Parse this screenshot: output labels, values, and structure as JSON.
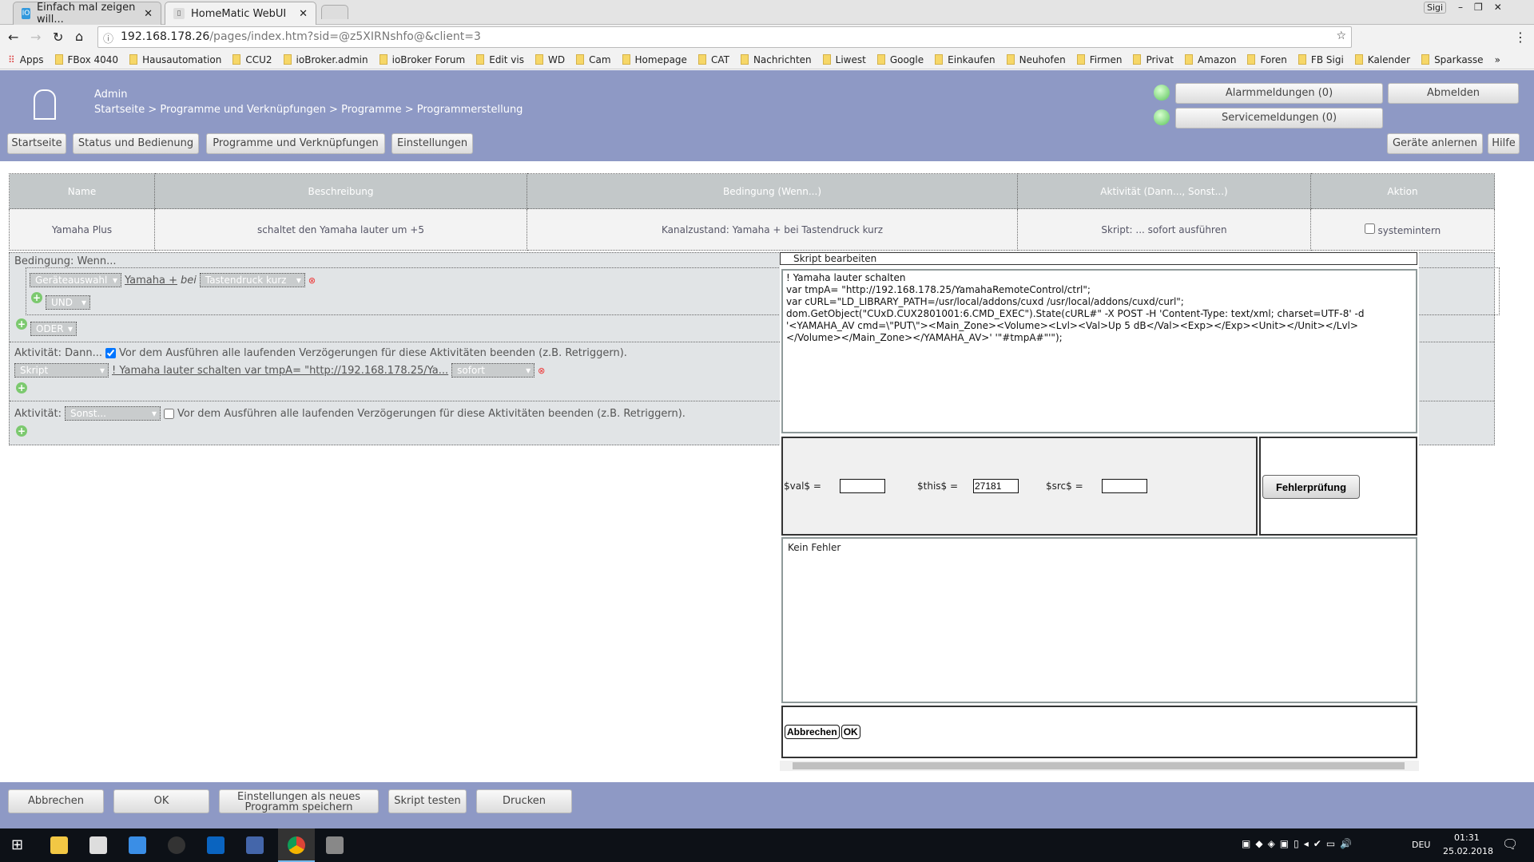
{
  "browser": {
    "tabs": [
      {
        "label": "Einfach mal zeigen will...",
        "icon": "iobroker-icon"
      },
      {
        "label": "HomeMatic WebUI",
        "icon": "homematic-icon"
      }
    ],
    "url_host": "192.168.178.26",
    "url_path": "/pages/index.htm?sid=@z5XIRNshfo@&client=3",
    "profile": "Sigi",
    "bookmarks": [
      "Apps",
      "FBox 4040",
      "Hausautomation",
      "CCU2",
      "ioBroker.admin",
      "ioBroker Forum",
      "Edit vis",
      "WD",
      "Cam",
      "Homepage",
      "CAT",
      "Nachrichten",
      "Liwest",
      "Google",
      "Einkaufen",
      "Neuhofen",
      "Firmen",
      "Privat",
      "Amazon",
      "Foren",
      "FB Sigi",
      "Kalender",
      "Sparkasse"
    ],
    "more": "»"
  },
  "header": {
    "user": "Admin",
    "breadcrumb": "Startseite > Programme und Verknüpfungen > Programme > Programmerstellung",
    "nav": [
      "Startseite",
      "Status und Bedienung",
      "Programme und Verknüpfungen",
      "Einstellungen"
    ],
    "alarm": "Alarmmeldungen (0)",
    "service": "Servicemeldungen (0)",
    "logout": "Abmelden",
    "teach": "Geräte anlernen",
    "help": "Hilfe",
    "status_color": "#5bc45b"
  },
  "table": {
    "headers": [
      "Name",
      "Beschreibung",
      "Bedingung (Wenn...)",
      "Aktivität (Dann..., Sonst...)",
      "Aktion"
    ],
    "row": [
      "Yamaha Plus",
      "schaltet den Yamaha lauter um +5",
      "Kanalzustand: Yamaha + bei Tastendruck kurz",
      "Skript: ... sofort ausführen",
      "systemintern"
    ]
  },
  "condition": {
    "title": "Bedingung: Wenn...",
    "device_select": "Geräteauswahl",
    "device": "Yamaha +",
    "bei": "bei",
    "trigger": "Tastendruck kurz",
    "and": "UND",
    "or": "ODER"
  },
  "activity_then": {
    "title": "Aktivität: Dann...",
    "checkbox_label": "Vor dem Ausführen alle laufenden Verzögerungen für diese Aktivitäten beenden (z.B. Retriggern).",
    "checked": true,
    "type": "Skript",
    "script_link": "! Yamaha lauter schalten var tmpA= \"http://192.168.178.25/Ya...",
    "timing": "sofort"
  },
  "activity_else": {
    "title": "Aktivität:",
    "select": "Sonst...",
    "checkbox_label": "Vor dem Ausführen alle laufenden Verzögerungen für diese Aktivitäten beenden (z.B. Retriggern).",
    "checked": false
  },
  "dialog": {
    "title": "Skript bearbeiten",
    "code": "! Yamaha lauter schalten\nvar tmpA= \"http://192.168.178.25/YamahaRemoteControl/ctrl\";\nvar cURL=\"LD_LIBRARY_PATH=/usr/local/addons/cuxd /usr/local/addons/cuxd/curl\";\ndom.GetObject(\"CUxD.CUX2801001:6.CMD_EXEC\").State(cURL#\" -X POST -H 'Content-Type: text/xml; charset=UTF-8' -d '<YAMAHA_AV cmd=\\\"PUT\\\"><Main_Zone><Volume><Lvl><Val>Up 5 dB</Val><Exp></Exp><Unit></Unit></Lvl></Volume></Main_Zone></YAMAHA_AV>' '\"#tmpA#\"'\");",
    "val_label": "$val$ =",
    "val": "",
    "this_label": "$this$ =",
    "this": "27181",
    "src_label": "$src$ =",
    "src": "",
    "check_button": "Fehlerprüfung",
    "result": "Kein Fehler",
    "cancel": "Abbrechen",
    "ok": "OK"
  },
  "footer": {
    "buttons": [
      "Abbrechen",
      "OK",
      "Einstellungen als neues Programm speichern",
      "Skript testen",
      "Drucken"
    ]
  },
  "taskbar": {
    "lang": "DEU",
    "time": "01:31",
    "date": "25.02.2018"
  }
}
